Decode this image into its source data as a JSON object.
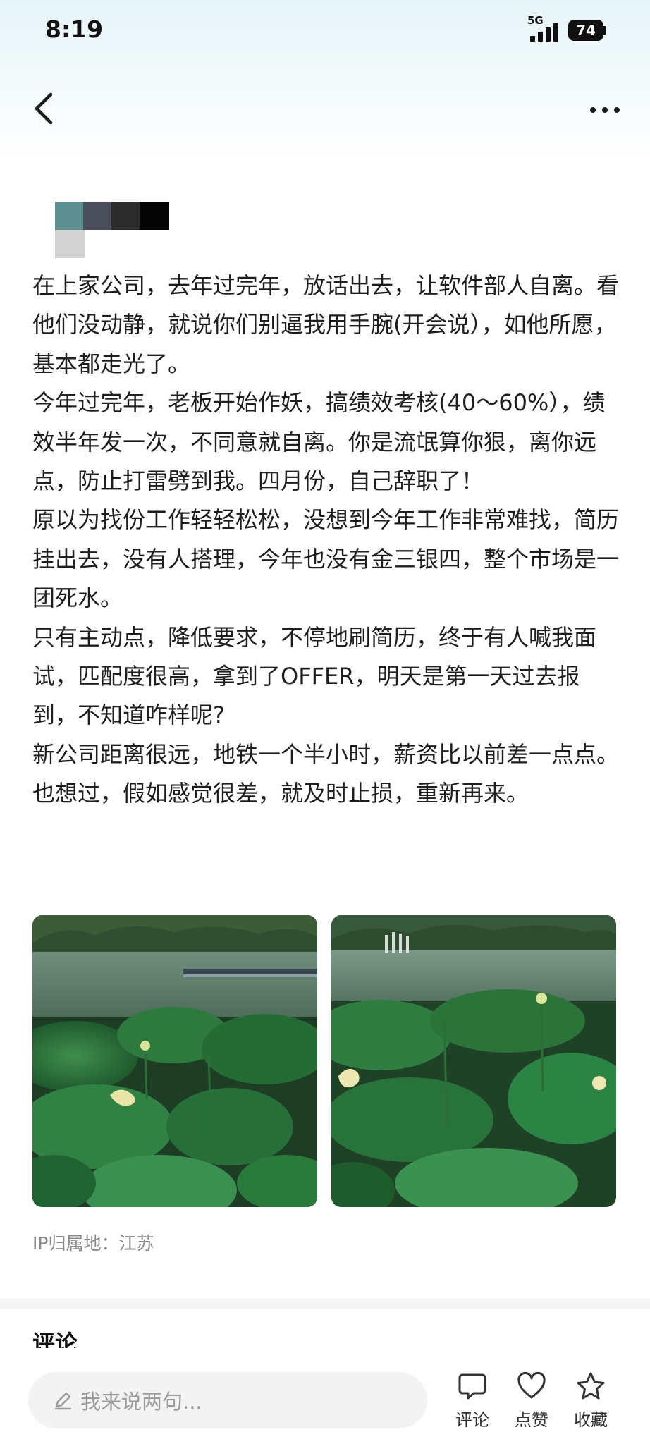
{
  "status_bar": {
    "time": "8:19",
    "network": "5G",
    "battery": "74"
  },
  "nav": {
    "back_icon": "chevron-left-icon",
    "more_icon": "ellipsis-icon"
  },
  "post": {
    "paragraphs": [
      "在上家公司，去年过完年，放话出去，让软件部人自离。看他们没动静，就说你们别逼我用手腕(开会说），如他所愿，基本都走光了。",
      "今年过完年，老板开始作妖，搞绩效考核(40～60%），绩效半年发一次，不同意就自离。你是流氓算你狠，离你远点，防止打雷劈到我。四月份，自己辞职了！",
      "原以为找份工作轻轻松松，没想到今年工作非常难找，简历挂出去，没有人搭理，今年也没有金三银四，整个市场是一团死水。",
      "只有主动点，降低要求，不停地刷简历，终于有人喊我面试，匹配度很高，拿到了OFFER，明天是第一天过去报到，不知道咋样呢?",
      "新公司距离很远，地铁一个半小时，薪资比以前差一点点。也想过，假如感觉很差，就及时止损，重新再来。"
    ],
    "ip_location": "IP归属地：江苏"
  },
  "comments": {
    "heading": "评论"
  },
  "bottom_bar": {
    "input_placeholder": "我来说两句...",
    "actions": [
      {
        "label": "评论",
        "icon": "comment-icon"
      },
      {
        "label": "点赞",
        "icon": "heart-icon"
      },
      {
        "label": "收藏",
        "icon": "star-icon"
      }
    ]
  },
  "colors": {
    "header_gradient_top": "#e6f5f8",
    "text": "#1e1e1e",
    "muted": "#8a8a8a",
    "input_bg": "#f3f3f3"
  }
}
